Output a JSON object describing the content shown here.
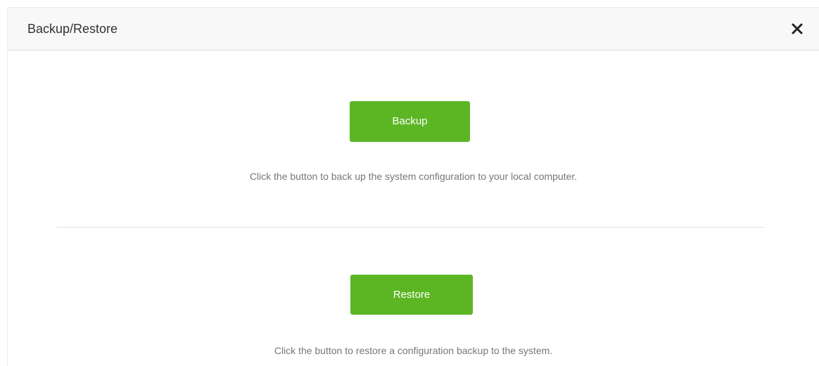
{
  "dialog": {
    "title": "Backup/Restore",
    "close_icon": "close-icon"
  },
  "backup": {
    "button_label": "Backup",
    "description": "Click the button to back up the system configuration to your local computer."
  },
  "restore": {
    "button_label": "Restore",
    "description": "Click the button to restore a configuration backup to the system."
  },
  "colors": {
    "accent": "#5cb624",
    "header_bg": "#f8f8f8",
    "description_text": "#777777"
  }
}
